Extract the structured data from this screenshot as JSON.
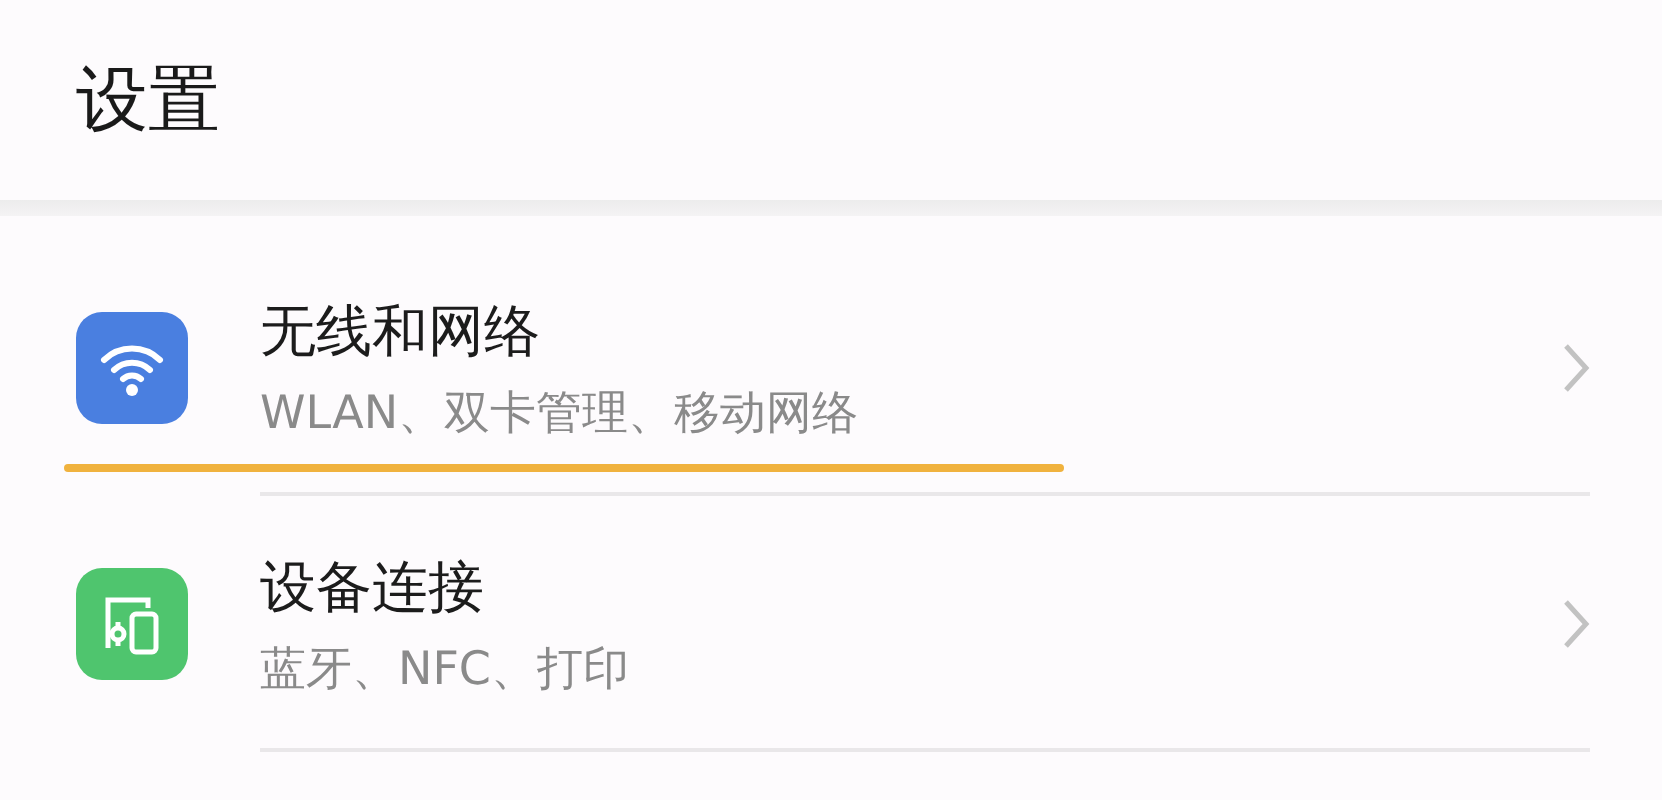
{
  "header": {
    "title": "设置"
  },
  "items": [
    {
      "kind": "wifi",
      "color": "#4a7fe0",
      "title": "无线和网络",
      "subtitle": "WLAN、双卡管理、移动网络",
      "highlighted": true
    },
    {
      "kind": "devices",
      "color": "#4fc56e",
      "title": "设备连接",
      "subtitle": "蓝牙、NFC、打印",
      "highlighted": false
    }
  ]
}
